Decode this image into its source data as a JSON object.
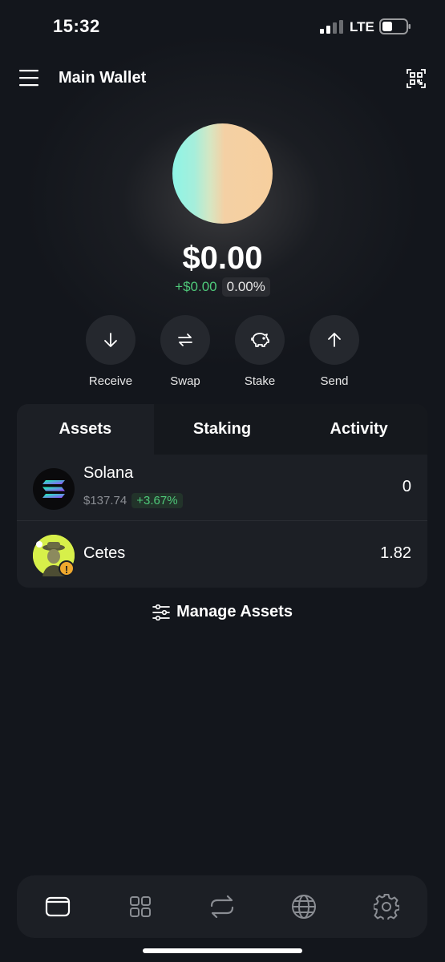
{
  "status_bar": {
    "time": "15:32",
    "network": "LTE"
  },
  "header": {
    "title": "Main Wallet",
    "menu_icon": "hamburger-menu-icon",
    "qr_icon": "qr-scan-icon"
  },
  "balance": {
    "amount": "$0.00",
    "change_usd": "+$0.00",
    "change_pct": "0.00%"
  },
  "actions": [
    {
      "label": "Receive",
      "icon": "arrow-down-icon"
    },
    {
      "label": "Swap",
      "icon": "swap-arrows-icon"
    },
    {
      "label": "Stake",
      "icon": "piggy-bank-icon"
    },
    {
      "label": "Send",
      "icon": "arrow-up-icon"
    }
  ],
  "tabs": [
    {
      "label": "Assets",
      "active": true
    },
    {
      "label": "Staking",
      "active": false
    },
    {
      "label": "Activity",
      "active": false
    }
  ],
  "assets": [
    {
      "name": "Solana",
      "price": "$137.74",
      "change": "+3.67%",
      "amount": "0",
      "icon": "solana-logo-icon"
    },
    {
      "name": "Cetes",
      "amount": "1.82",
      "icon": "cetes-token-icon",
      "warning": "!"
    }
  ],
  "manage_assets": {
    "label": "Manage Assets",
    "icon": "sliders-icon"
  },
  "bottom_nav": [
    {
      "icon": "wallet-icon",
      "active": true
    },
    {
      "icon": "apps-grid-icon",
      "active": false
    },
    {
      "icon": "swap-icon",
      "active": false
    },
    {
      "icon": "globe-icon",
      "active": false
    },
    {
      "icon": "settings-gear-icon",
      "active": false
    }
  ],
  "colors": {
    "background": "#13161c",
    "card": "#1c1f25",
    "positive": "#4fc97a",
    "warning": "#f0a92e"
  }
}
